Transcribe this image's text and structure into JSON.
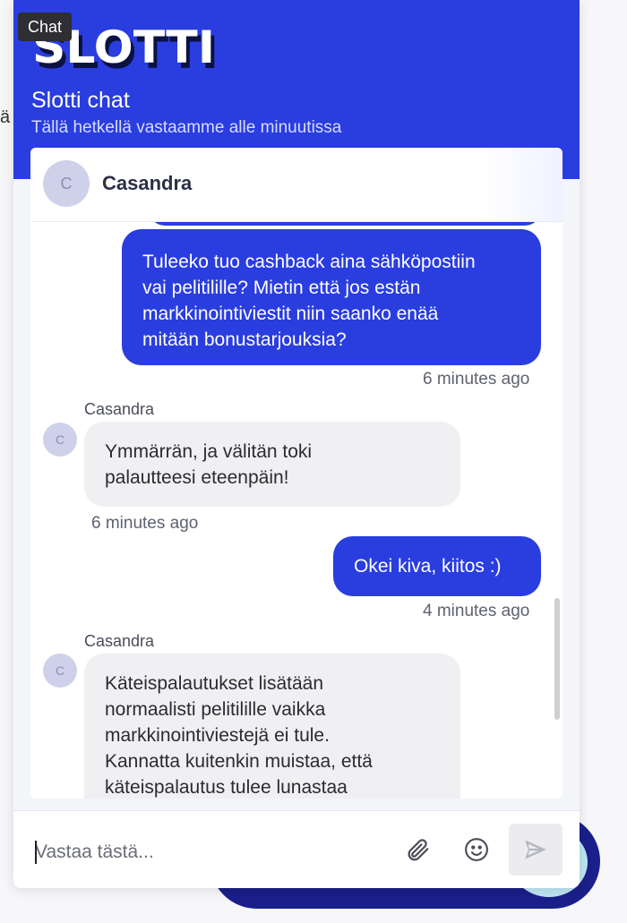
{
  "background": {
    "partial_text": "ä"
  },
  "tooltip": {
    "label": "Chat"
  },
  "header": {
    "logo_text": "SLOTTI",
    "title": "Slotti chat",
    "subtitle": "Tällä hetkellä vastaamme alle minuutissa"
  },
  "agent": {
    "initial": "C",
    "name": "Casandra"
  },
  "messages": [
    {
      "from": "user",
      "lines": [
        "Tuleeko tuo cashback aina sähköpostiin",
        "vai pelitilille? Mietin että jos estän",
        "markkinointiviestit niin saanko enää",
        "mitään bonustarjouksia?"
      ],
      "time": "6 minutes ago"
    },
    {
      "from": "agent",
      "sender": "Casandra",
      "initial": "C",
      "lines": [
        "Ymmärrän, ja välitän toki",
        "palautteesi eteenpäin!"
      ],
      "time": "6 minutes ago"
    },
    {
      "from": "user",
      "lines": [
        "Okei kiva, kiitos :)"
      ],
      "time": "4 minutes ago"
    },
    {
      "from": "agent",
      "sender": "Casandra",
      "initial": "C",
      "lines": [
        "Käteispalautukset lisätään",
        "normaalisti pelitilille vaikka",
        "markkinointiviestejä ei tule.",
        "Kannatta kuitenkin muistaa, että",
        "käteispalautus tulee lunastaa"
      ]
    }
  ],
  "composer": {
    "placeholder": "Vastaa tästä...",
    "attach_icon": "paperclip-icon",
    "emoji_icon": "smiley-icon",
    "send_icon": "send-arrow-icon"
  },
  "colors": {
    "brand_blue": "#2a3ddf",
    "agent_bubble": "#f0f0f2",
    "launcher": "#1a1f8a"
  }
}
